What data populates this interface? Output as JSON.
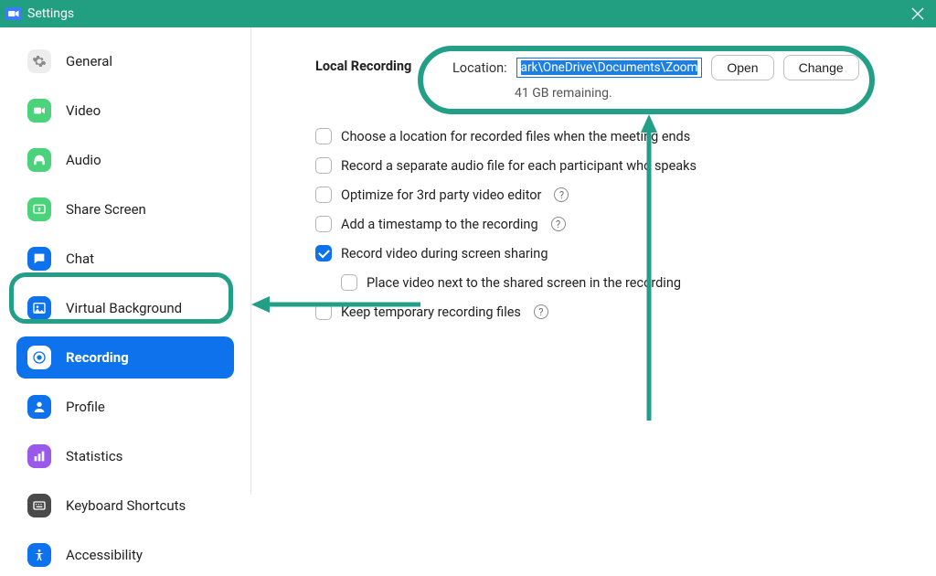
{
  "window": {
    "title": "Settings"
  },
  "sidebar": {
    "items": [
      {
        "label": "General"
      },
      {
        "label": "Video"
      },
      {
        "label": "Audio"
      },
      {
        "label": "Share Screen"
      },
      {
        "label": "Chat"
      },
      {
        "label": "Virtual Background"
      },
      {
        "label": "Recording"
      },
      {
        "label": "Profile"
      },
      {
        "label": "Statistics"
      },
      {
        "label": "Keyboard Shortcuts"
      },
      {
        "label": "Accessibility"
      }
    ],
    "active_index": 6
  },
  "content": {
    "section_title": "Local Recording",
    "location_label": "Location:",
    "location_path": "ark\\OneDrive\\Documents\\Zoom",
    "open_btn": "Open",
    "change_btn": "Change",
    "remaining": "41 GB remaining.",
    "options": [
      {
        "label": "Choose a location for recorded files when the meeting ends",
        "checked": false,
        "help": false
      },
      {
        "label": "Record a separate audio file for each participant who speaks",
        "checked": false,
        "help": false
      },
      {
        "label": "Optimize for 3rd party video editor",
        "checked": false,
        "help": true
      },
      {
        "label": "Add a timestamp to the recording",
        "checked": false,
        "help": true
      },
      {
        "label": "Record video during screen sharing",
        "checked": true,
        "help": false
      },
      {
        "label": "Place video next to the shared screen in the recording",
        "checked": false,
        "help": false,
        "sub": true
      },
      {
        "label": "Keep temporary recording files",
        "checked": false,
        "help": true
      }
    ]
  },
  "annotation": {
    "arrow_color": "#249f87"
  }
}
